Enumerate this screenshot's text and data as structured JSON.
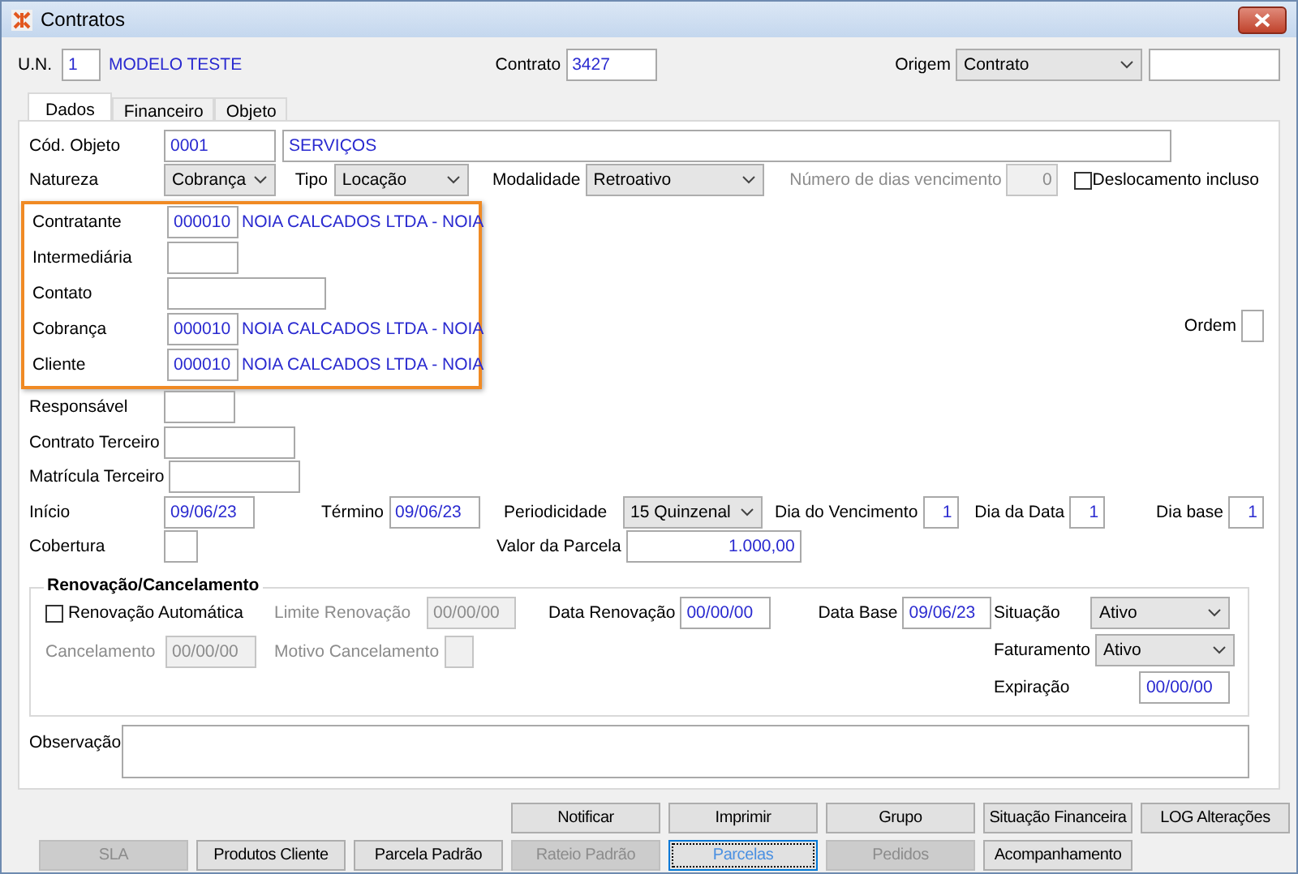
{
  "window": {
    "title": "Contratos"
  },
  "header": {
    "un": {
      "label": "U.N.",
      "value": "1",
      "name": "MODELO TESTE"
    },
    "contrato": {
      "label": "Contrato",
      "value": "3427"
    },
    "origem": {
      "label": "Origem",
      "value": "Contrato"
    }
  },
  "tabs": [
    {
      "label": "Dados",
      "selected": true
    },
    {
      "label": "Financeiro",
      "selected": false
    },
    {
      "label": "Objeto",
      "selected": false
    }
  ],
  "objeto": {
    "label": "Cód. Objeto",
    "code": "0001",
    "name": "SERVIÇOS"
  },
  "natureza": {
    "label": "Natureza",
    "value": "Cobrança"
  },
  "tipo": {
    "label": "Tipo",
    "value": "Locação"
  },
  "modalidade": {
    "label": "Modalidade",
    "value": "Retroativo"
  },
  "dias_vencimento": {
    "label": "Número de dias vencimento",
    "value": "0",
    "disabled": true
  },
  "deslocamento": {
    "label": "Deslocamento incluso",
    "checked": false
  },
  "parties": [
    {
      "label": "Contratante",
      "kind": "code",
      "code": "000010",
      "name": "NOIA CALCADOS LTDA - NOIA"
    },
    {
      "label": "Intermediária",
      "kind": "code"
    },
    {
      "label": "Contato",
      "kind": "text"
    },
    {
      "label": "Cobrança",
      "kind": "code",
      "code": "000010",
      "name": "NOIA CALCADOS LTDA - NOIA"
    },
    {
      "label": "Cliente",
      "kind": "code",
      "code": "000010",
      "name": "NOIA CALCADOS LTDA - NOIA"
    }
  ],
  "ordem": {
    "label": "Ordem"
  },
  "others": [
    {
      "label": "Responsável",
      "kind": "code"
    },
    {
      "label": "Contrato Terceiro",
      "kind": "text"
    },
    {
      "label": "Matrícula Terceiro",
      "kind": "text"
    }
  ],
  "inicio": {
    "label": "Início",
    "value": "09/06/23"
  },
  "termino": {
    "label": "Término",
    "value": "09/06/23"
  },
  "periodicidade": {
    "label": "Periodicidade",
    "value": "15 Quinzenal"
  },
  "dia_vencimento": {
    "label": "Dia do Vencimento",
    "value": "1"
  },
  "dia_data": {
    "label": "Dia da Data",
    "value": "1"
  },
  "dia_base": {
    "label": "Dia base",
    "value": "1"
  },
  "cobertura": {
    "label": "Cobertura"
  },
  "valor_parcela": {
    "label": "Valor da Parcela",
    "value": "1.000,00"
  },
  "renovacao": {
    "title": "Renovação/Cancelamento",
    "automatica": {
      "label": "Renovação Automática",
      "checked": false
    },
    "limite": {
      "label": "Limite Renovação",
      "value": "00/00/00",
      "disabled": true
    },
    "data_renovacao": {
      "label": "Data Renovação",
      "value": "00/00/00",
      "disabled": false
    },
    "data_base": {
      "label": "Data Base",
      "value": "09/06/23",
      "disabled": false
    },
    "cancelamento": {
      "label": "Cancelamento",
      "value": "00/00/00",
      "disabled": true
    },
    "motivo": {
      "label": "Motivo Cancelamento",
      "disabled": true
    },
    "situacao": {
      "label": "Situação",
      "value": "Ativo"
    },
    "faturamento": {
      "label": "Faturamento",
      "value": "Ativo"
    },
    "expiracao": {
      "label": "Expiração",
      "value": "00/00/00"
    }
  },
  "observacao": {
    "label": "Observação"
  },
  "buttons_top": [
    {
      "label": "Notificar",
      "disabled": false,
      "focused": false
    },
    {
      "label": "Imprimir",
      "disabled": false,
      "focused": false
    },
    {
      "label": "Grupo",
      "disabled": false,
      "focused": false
    },
    {
      "label": "Situação Financeira",
      "disabled": false,
      "focused": false
    },
    {
      "label": "LOG Alterações",
      "disabled": false,
      "focused": false
    }
  ],
  "buttons_bottom": [
    {
      "label": "SLA",
      "disabled": true,
      "focused": false
    },
    {
      "label": "Produtos Cliente",
      "disabled": false,
      "focused": false
    },
    {
      "label": "Parcela Padrão",
      "disabled": false,
      "focused": false
    },
    {
      "label": "Rateio Padrão",
      "disabled": true,
      "focused": false
    },
    {
      "label": "Parcelas",
      "disabled": false,
      "focused": true
    },
    {
      "label": "Pedidos",
      "disabled": true,
      "focused": false
    },
    {
      "label": "Acompanhamento",
      "disabled": false,
      "focused": false
    }
  ]
}
